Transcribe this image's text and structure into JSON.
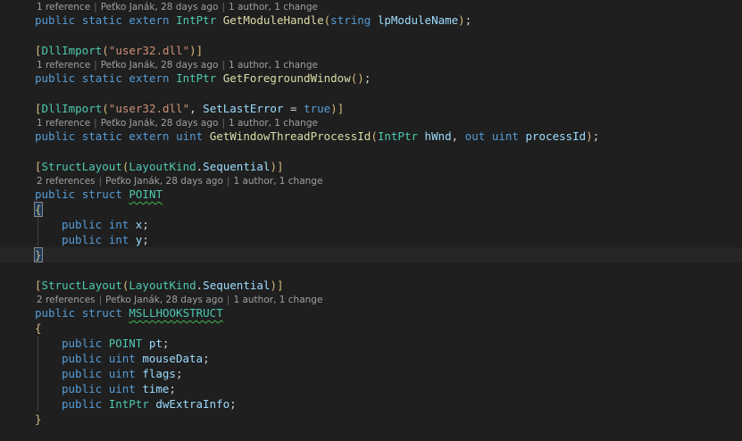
{
  "lenses": {
    "l1": {
      "refs": "1 reference",
      "author": "Peťko Janák, 28 days ago",
      "changes": "1 author, 1 change"
    },
    "l2": {
      "refs": "1 reference",
      "author": "Peťko Janák, 28 days ago",
      "changes": "1 author, 1 change"
    },
    "l3": {
      "refs": "1 reference",
      "author": "Peťko Janák, 28 days ago",
      "changes": "1 author, 1 change"
    },
    "l4": {
      "refs": "2 references",
      "author": "Peťko Janák, 28 days ago",
      "changes": "1 author, 1 change"
    },
    "l5": {
      "refs": "2 references",
      "author": "Peťko Janák, 28 days ago",
      "changes": "1 author, 1 change"
    }
  },
  "code": {
    "kw_public": "public",
    "kw_static": "static",
    "kw_extern": "extern",
    "kw_struct": "struct",
    "kw_uint": "uint",
    "kw_int": "int",
    "kw_out": "out",
    "kw_string": "string",
    "kw_true": "true",
    "t_IntPtr": "IntPtr",
    "t_DllImport": "DllImport",
    "t_StructLayout": "StructLayout",
    "t_LayoutKind": "LayoutKind",
    "t_POINT": "POINT",
    "t_MSLL": "MSLLHOOKSTRUCT",
    "f_GetModuleHandle": "GetModuleHandle",
    "f_GetForegroundWindow": "GetForegroundWindow",
    "f_GetWindowThreadProcessId": "GetWindowThreadProcessId",
    "p_lpModuleName": "lpModuleName",
    "p_hWnd": "hWnd",
    "p_processId": "processId",
    "s_user32": "\"user32.dll\"",
    "p_SetLastError": "SetLastError",
    "p_Sequential": "Sequential",
    "m_x": "x",
    "m_y": "y",
    "m_pt": "pt",
    "m_mouseData": "mouseData",
    "m_flags": "flags",
    "m_time": "time",
    "m_dwExtraInfo": "dwExtraInfo"
  }
}
